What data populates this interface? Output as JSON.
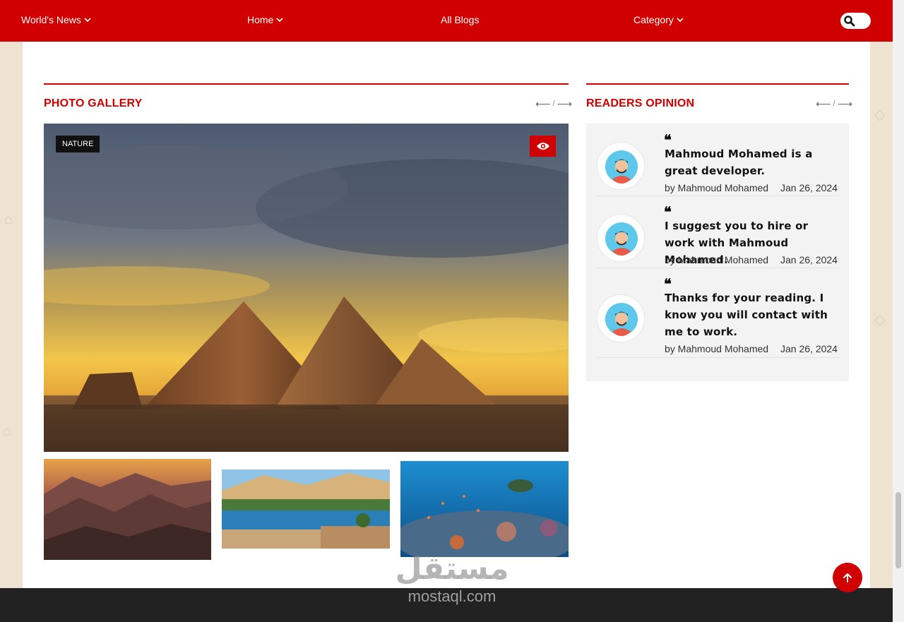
{
  "nav": {
    "items": [
      {
        "label": "World's News",
        "has_dropdown": true
      },
      {
        "label": "Home",
        "has_dropdown": true
      },
      {
        "label": "All Blogs",
        "has_dropdown": false
      },
      {
        "label": "Category",
        "has_dropdown": true
      }
    ],
    "search_icon": "search-icon"
  },
  "gallery": {
    "title": "PHOTO GALLERY",
    "arrow_prev": "⟵",
    "arrow_sep": "/",
    "arrow_next": "⟶",
    "main_tag": "NATURE",
    "view_icon": "eye-icon",
    "main_image": "pyramids-at-sunset",
    "thumbnails": [
      "sinai-mountains",
      "nile-river-aswan",
      "coral-reef-turtle"
    ]
  },
  "opinions": {
    "title": "READERS OPINION",
    "arrow_prev": "⟵",
    "arrow_sep": "/",
    "arrow_next": "⟶",
    "items": [
      {
        "quote_mark": "❝",
        "text": "Mahmoud Mohamed is a great developer.",
        "author": "by Mahmoud Mohamed",
        "date": "Jan 26, 2024"
      },
      {
        "quote_mark": "❝",
        "text": "I suggest you to hire or work with Mahmoud Mohamed.",
        "author": "by Mahmoud Mohamed",
        "date": "Jan 26, 2024"
      },
      {
        "quote_mark": "❝",
        "text": "Thanks for your reading. I know you will contact with me to work.",
        "author": "by Mahmoud Mohamed",
        "date": "Jan 26, 2024"
      }
    ]
  },
  "watermark": {
    "arabic": "مستقل",
    "latin": "mostaql.com"
  },
  "colors": {
    "brand": "#d10000",
    "footer": "#222222",
    "panel": "#f3f3f3"
  }
}
